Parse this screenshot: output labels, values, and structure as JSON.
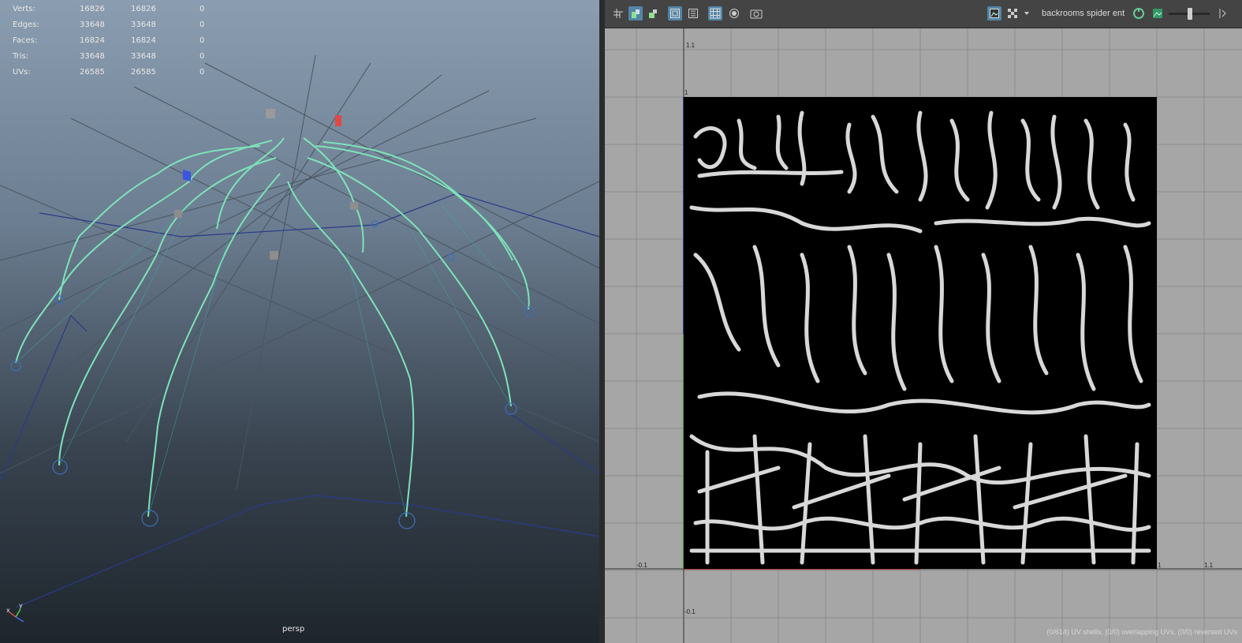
{
  "stats": [
    {
      "label": "Verts:",
      "v1": "16826",
      "v2": "16826",
      "v3": "0"
    },
    {
      "label": "Edges:",
      "v1": "33648",
      "v2": "33648",
      "v3": "0"
    },
    {
      "label": "Faces:",
      "v1": "16824",
      "v2": "16824",
      "v3": "0"
    },
    {
      "label": "Tris:",
      "v1": "33648",
      "v2": "33648",
      "v3": "0"
    },
    {
      "label": "UVs:",
      "v1": "26585",
      "v2": "26585",
      "v3": "0"
    }
  ],
  "viewport": {
    "camera": "persp",
    "axis_x": "x",
    "axis_y": "y"
  },
  "uv_editor": {
    "texture_name": "backrooms spider ent",
    "tick_labels": {
      "top": "1.1",
      "one_v": "1",
      "left": "-0.1",
      "one_u": "1",
      "right": "1.1",
      "bottom": "-0.1"
    },
    "status": "(0/614) UV shells, (0/0) overlapping UVs, (0/0) reversed UVs"
  },
  "toolbar_icons": [
    "uv-grid-icon",
    "uv-shade-icon",
    "uv-checker-small-icon",
    "uv-frame-icon",
    "uv-frame2-icon",
    "uv-grid-toggle-icon",
    "uv-snap-icon",
    "uv-snapshot-icon",
    "image-display-icon",
    "checker-icon",
    "dropdown-arrow-icon",
    "texture-refresh-icon",
    "image-icon"
  ],
  "colors": {
    "wire": "#7de3b8",
    "uv_shell": "#d8d8d8",
    "uv_bg": "#000000",
    "grid": "#8c8c8c",
    "accent": "#5285a6"
  }
}
